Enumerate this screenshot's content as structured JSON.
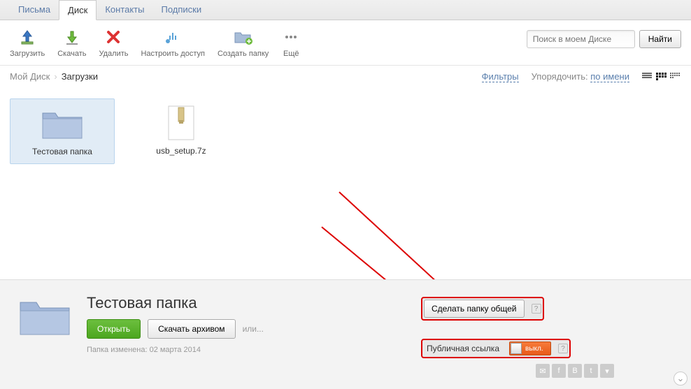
{
  "tabs": {
    "mail": "Письма",
    "disk": "Диск",
    "contacts": "Контакты",
    "subs": "Подписки"
  },
  "toolbar": {
    "upload": "Загрузить",
    "download": "Скачать",
    "delete": "Удалить",
    "access": "Настроить доступ",
    "newfolder": "Создать папку",
    "more": "Ещё"
  },
  "search": {
    "placeholder": "Поиск в моем Диске",
    "button": "Найти"
  },
  "crumb": {
    "root": "Мой Диск",
    "current": "Загрузки"
  },
  "filters": "Фильтры",
  "sort": {
    "label": "Упорядочить:",
    "value": "по имени"
  },
  "files": [
    {
      "name": "Тестовая папка",
      "type": "folder"
    },
    {
      "name": "usb_setup.7z",
      "type": "archive"
    }
  ],
  "details": {
    "title": "Тестовая папка",
    "open": "Открыть",
    "archive": "Скачать архивом",
    "or": "или...",
    "modified": "Папка изменена: 02 марта 2014",
    "share_btn": "Сделать папку общей",
    "public_label": "Публичная ссылка",
    "toggle": "выкл."
  }
}
